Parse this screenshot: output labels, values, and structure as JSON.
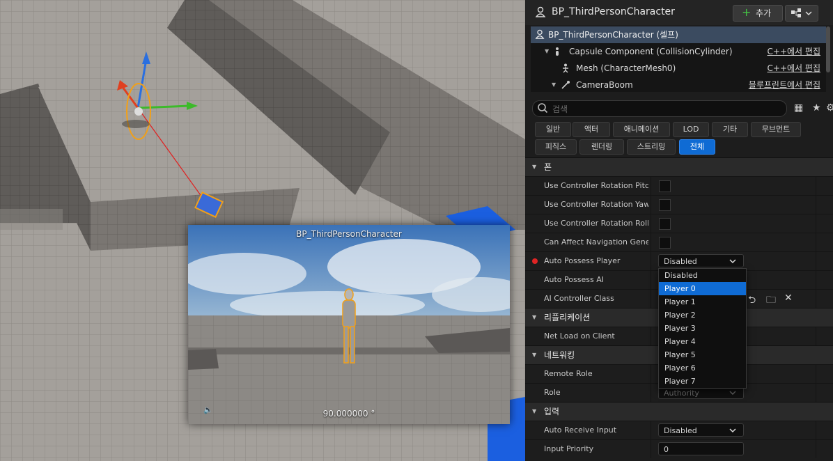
{
  "viewport": {
    "pip_title": "BP_ThirdPersonCharacter",
    "pip_fov": "90.000000 °"
  },
  "panel": {
    "title": "BP_ThirdPersonCharacter",
    "add_button": "추가",
    "components": [
      {
        "label": "BP_ThirdPersonCharacter (셀프)",
        "edit": ""
      },
      {
        "label": "Capsule Component (CollisionCylinder)",
        "edit": "C++에서 편집"
      },
      {
        "label": "Mesh (CharacterMesh0)",
        "edit": "C++에서 편집"
      },
      {
        "label": "CameraBoom",
        "edit": "블루프린트에서 편집"
      }
    ],
    "search_placeholder": "검색",
    "filters_row1": [
      "일반",
      "액터",
      "애니메이션",
      "LOD",
      "기타",
      "무브먼트"
    ],
    "filters_row2": [
      "피직스",
      "렌더링",
      "스트리밍",
      "전체"
    ],
    "active_filter": "전체",
    "sections": {
      "pawn": "폰",
      "replication": "리플리케이션",
      "networking": "네트워킹",
      "input": "입력"
    },
    "props": {
      "use_pitch": "Use Controller Rotation Pitch",
      "use_yaw": "Use Controller Rotation Yaw",
      "use_roll": "Use Controller Rotation Roll",
      "can_affect_nav": "Can Affect Navigation Gener...",
      "auto_possess_player": "Auto Possess Player",
      "auto_possess_player_value": "Disabled",
      "auto_possess_ai": "Auto Possess AI",
      "ai_controller_class": "AI Controller Class",
      "net_load": "Net Load on Client",
      "remote_role": "Remote Role",
      "role": "Role",
      "role_value": "Authority",
      "auto_receive_input": "Auto Receive Input",
      "auto_receive_input_value": "Disabled",
      "input_priority": "Input Priority",
      "input_priority_value": "0"
    },
    "dropdown_options": [
      "Disabled",
      "Player 0",
      "Player 1",
      "Player 2",
      "Player 3",
      "Player 4",
      "Player 5",
      "Player 6",
      "Player 7"
    ],
    "dropdown_highlighted": "Player 0"
  },
  "colors": {
    "accent": "#0f6bd4",
    "selection_row": "#3b4b60",
    "modified_dot": "#e02424",
    "add_plus": "#44c244"
  }
}
